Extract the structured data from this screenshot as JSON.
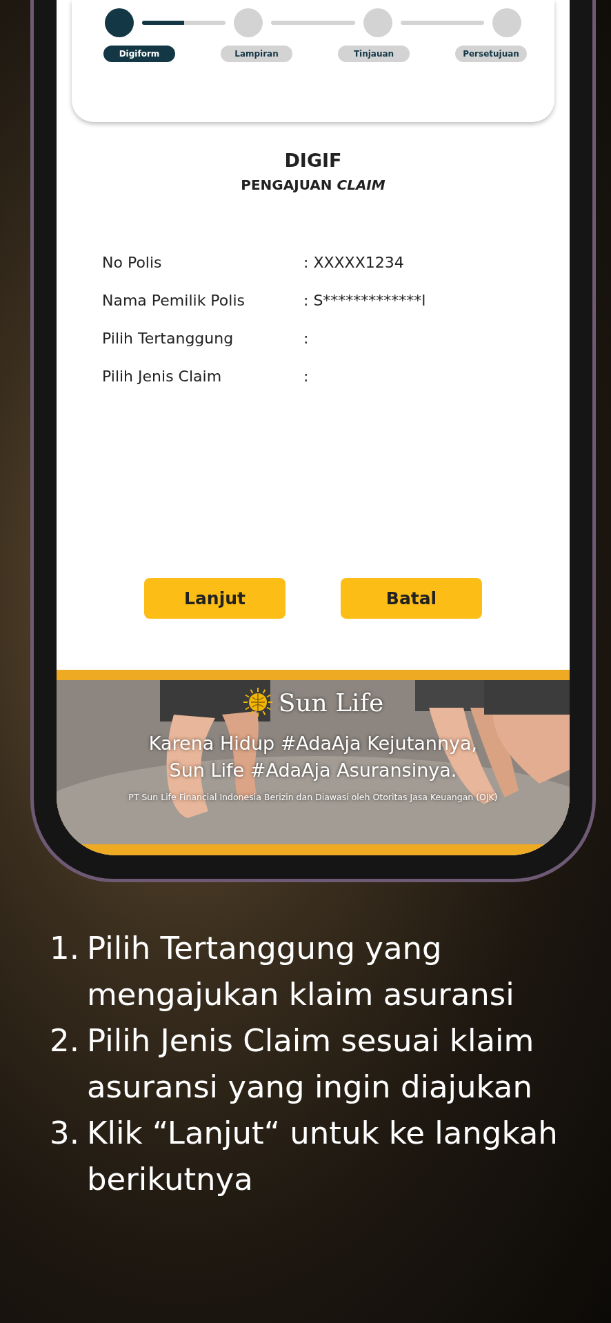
{
  "stepper": {
    "steps": [
      {
        "label": "Digiform",
        "selected": true
      },
      {
        "label": "Lampiran",
        "selected": false
      },
      {
        "label": "Tinjauan",
        "selected": false
      },
      {
        "label": "Persetujuan",
        "selected": false
      }
    ],
    "level": 0.5
  },
  "form": {
    "title": "DIGIF",
    "subtitle": "PENGAJUAN *CLAIM*",
    "rows": [
      {
        "label": "No Polis",
        "value": ": XXXXX1234"
      },
      {
        "label": "Nama Pemilik Polis",
        "value": ": S*************l"
      },
      {
        "label": "Pilih Tertanggung",
        "value": ":"
      },
      {
        "label": "Pilih Jenis Claim",
        "value": ":"
      }
    ],
    "buttons": [
      "Lanjut",
      "Batal"
    ]
  },
  "banner": {
    "brand": "Sun Life",
    "tagline": [
      "Karena Hidup #AdaAja Kejutannya,",
      "Sun Life #AdaAja Asuransinya."
    ],
    "disclaimer": "PT Sun Life Financial Indonesia Berizin dan Diawasi oleh Otoritas Jasa Keuangan (OJK)"
  },
  "instructions": [
    {
      "number": "1.",
      "text": "Pilih Tertanggung yang mengajukan klaim asuransi"
    },
    {
      "number": "2.",
      "text": "Pilih Jenis Claim sesuai klaim asuransi yang ingin diajukan"
    },
    {
      "number": "3.",
      "text": "Klik “Lanjut“ untuk ke langkah berikutnya"
    }
  ]
}
